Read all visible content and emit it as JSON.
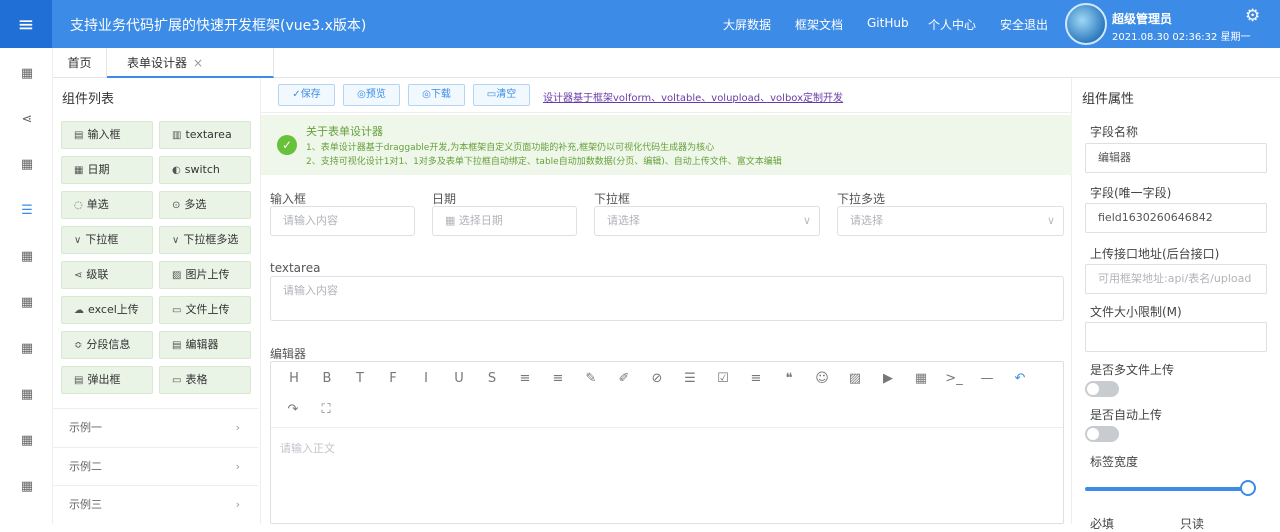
{
  "header": {
    "title": "支持业务代码扩展的快速开发框架(vue3.x版本)",
    "nav": [
      "大屏数据",
      "框架文档",
      "GitHub",
      "个人中心",
      "安全退出"
    ],
    "user_name": "超级管理员",
    "datetime": "2021.08.30 02:36:32 星期一",
    "menu_icon": "menu-icon",
    "settings_icon": "gear-icon",
    "accent": "#3c8ce7"
  },
  "tabs": {
    "home": "首页",
    "active": "表单设计器",
    "close": "×"
  },
  "components": {
    "title": "组件列表",
    "items": [
      "输入框",
      "textarea",
      "日期",
      "switch",
      "单选",
      "多选",
      "下拉框",
      "下拉框多选",
      "级联",
      "图片上传",
      "excel上传",
      "文件上传",
      "分段信息",
      "编辑器",
      "弹出框",
      "表格"
    ],
    "examples": [
      "示例一",
      "示例二",
      "示例三"
    ]
  },
  "toolbar": {
    "save": "保存",
    "preview": "预览",
    "download": "下载",
    "clear": "清空",
    "link": "设计器基于框架volform、voltable、volupload、volbox定制开发"
  },
  "alert": {
    "title": "关于表单设计器",
    "line1": "1、表单设计器基于draggable开发,为本框架自定义页面功能的补充,框架仍以可视化代码生成器为核心",
    "line2": "2、支持可视化设计1对1、1对多及表单下拉框自动绑定、table自动加数数据(分页、编辑)、自动上传文件、富文本编辑"
  },
  "form": {
    "input_label": "输入框",
    "input_ph": "请输入内容",
    "date_label": "日期",
    "date_ph": "选择日期",
    "select_label": "下拉框",
    "select_ph": "请选择",
    "multi_label": "下拉多选",
    "multi_ph": "请选择",
    "textarea_label": "textarea",
    "textarea_ph": "请输入内容",
    "editor_label": "编辑器",
    "editor_ph": "请输入正文"
  },
  "props": {
    "title": "组件属性",
    "field_name_label": "字段名称",
    "field_name": "编辑器",
    "field_label": "字段(唯一字段)",
    "field": "field1630260646842",
    "upload_label": "上传接口地址(后台接口)",
    "upload_ph": "可用框架地址:api/表名/upload",
    "size_label": "文件大小限制(M)",
    "size": "",
    "multi_label": "是否多文件上传",
    "auto_label": "是否自动上传",
    "width_label": "标签宽度",
    "required_label": "必填",
    "readonly_label": "只读"
  }
}
